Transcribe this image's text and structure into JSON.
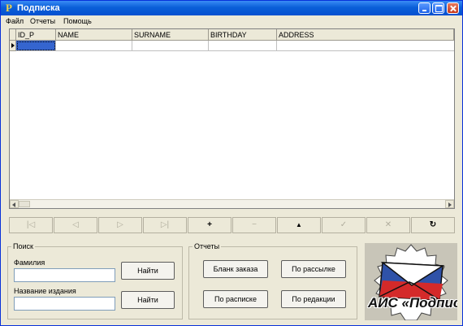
{
  "window": {
    "title": "Подписка"
  },
  "menu": [
    "Файл",
    "Отчеты",
    "Помощь"
  ],
  "grid": {
    "columns": [
      "ID_P",
      "NAME",
      "SURNAME",
      "BIRTHDAY",
      "ADDRESS"
    ]
  },
  "navigator": {
    "buttons": [
      {
        "name": "first",
        "glyph": "|◁",
        "enabled": false
      },
      {
        "name": "prior",
        "glyph": "◁",
        "enabled": false
      },
      {
        "name": "next",
        "glyph": "▷",
        "enabled": false
      },
      {
        "name": "last",
        "glyph": "▷|",
        "enabled": false
      },
      {
        "name": "insert",
        "glyph": "+",
        "enabled": true
      },
      {
        "name": "delete",
        "glyph": "−",
        "enabled": false
      },
      {
        "name": "edit",
        "glyph": "▲",
        "enabled": true
      },
      {
        "name": "post",
        "glyph": "✓",
        "enabled": false
      },
      {
        "name": "cancel",
        "glyph": "✕",
        "enabled": false
      },
      {
        "name": "refresh",
        "glyph": "↻",
        "enabled": true
      }
    ]
  },
  "search": {
    "title": "Поиск",
    "surname_label": "Фамилия",
    "surname_value": "",
    "title_label": "Название издания",
    "title_value": "",
    "find1": "Найти",
    "find2": "Найти"
  },
  "reports": {
    "title": "Отчеты",
    "order_form": "Бланк заказа",
    "by_mailing": "По рассылке",
    "by_receipt": "По расписке",
    "by_edition": "По редакции"
  },
  "logo": {
    "text": "АИС «Подписка»"
  },
  "colors": {
    "title_bar": "#0a5fd8",
    "window_bg": "#ece9d8",
    "selected_cell": "#3565cf"
  }
}
